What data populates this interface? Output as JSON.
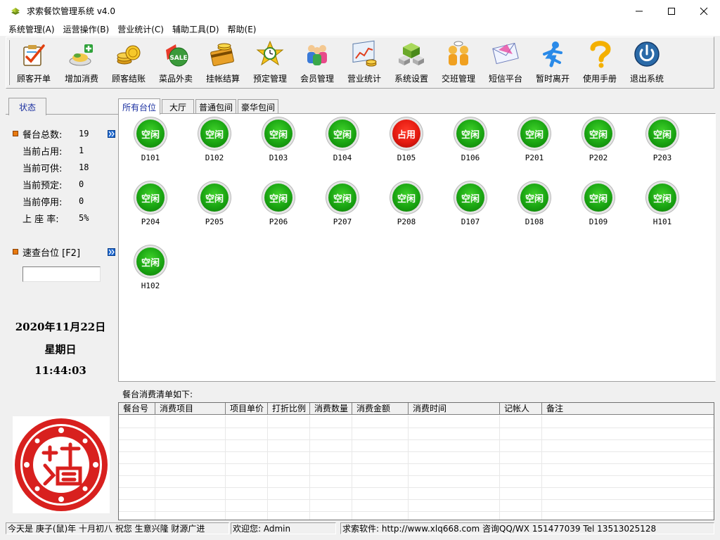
{
  "window": {
    "title": "求索餐饮管理系统 v4.0"
  },
  "menu": [
    {
      "label": "系统管理(A)"
    },
    {
      "label": "运营操作(B)"
    },
    {
      "label": "营业统计(C)"
    },
    {
      "label": "辅助工具(D)"
    },
    {
      "label": "帮助(E)"
    }
  ],
  "toolbar": [
    {
      "label": "顾客开单",
      "icon": "clipboard-check-icon"
    },
    {
      "label": "增加消费",
      "icon": "add-food-icon"
    },
    {
      "label": "顾客结账",
      "icon": "coins-icon"
    },
    {
      "label": "菜品外卖",
      "icon": "sale-bag-icon"
    },
    {
      "label": "挂帐结算",
      "icon": "card-credit-icon"
    },
    {
      "label": "预定管理",
      "icon": "clock-star-icon"
    },
    {
      "label": "会员管理",
      "icon": "members-icon"
    },
    {
      "label": "营业统计",
      "icon": "stats-chart-icon"
    },
    {
      "label": "系统设置",
      "icon": "cubes-icon"
    },
    {
      "label": "交班管理",
      "icon": "handover-people-icon"
    },
    {
      "label": "短信平台",
      "icon": "envelope-icon"
    },
    {
      "label": "暂时离开",
      "icon": "running-man-icon"
    },
    {
      "label": "使用手册",
      "icon": "question-icon"
    },
    {
      "label": "退出系统",
      "icon": "power-icon"
    }
  ],
  "left_panel": {
    "tab": "状态",
    "stats": [
      {
        "label": "餐台总数:",
        "value": "19"
      },
      {
        "label": "当前占用:",
        "value": "1"
      },
      {
        "label": "当前可供:",
        "value": "18"
      },
      {
        "label": "当前预定:",
        "value": "0"
      },
      {
        "label": "当前停用:",
        "value": "0"
      },
      {
        "label": "上 座 率:",
        "value": "5%"
      }
    ],
    "quick_search": "速查台位 [F2]",
    "quick_search_value": "",
    "date": "2020年11月22日",
    "weekday": "星期日",
    "time": "11:44:03",
    "seal_icon": "red-paper-cut-seal-icon"
  },
  "area_tabs": [
    {
      "label": "所有台位"
    },
    {
      "label": "大厅"
    },
    {
      "label": "普通包间"
    },
    {
      "label": "豪华包间"
    }
  ],
  "tables": [
    {
      "code": "D101",
      "status": "空闲",
      "state": "free"
    },
    {
      "code": "D102",
      "status": "空闲",
      "state": "free"
    },
    {
      "code": "D103",
      "status": "空闲",
      "state": "free"
    },
    {
      "code": "D104",
      "status": "空闲",
      "state": "free"
    },
    {
      "code": "D105",
      "status": "占用",
      "state": "busy"
    },
    {
      "code": "D106",
      "status": "空闲",
      "state": "free"
    },
    {
      "code": "P201",
      "status": "空闲",
      "state": "free"
    },
    {
      "code": "P202",
      "status": "空闲",
      "state": "free"
    },
    {
      "code": "P203",
      "status": "空闲",
      "state": "free"
    },
    {
      "code": "P204",
      "status": "空闲",
      "state": "free"
    },
    {
      "code": "P205",
      "status": "空闲",
      "state": "free"
    },
    {
      "code": "P206",
      "status": "空闲",
      "state": "free"
    },
    {
      "code": "P207",
      "status": "空闲",
      "state": "free"
    },
    {
      "code": "P208",
      "status": "空闲",
      "state": "free"
    },
    {
      "code": "D107",
      "status": "空闲",
      "state": "free"
    },
    {
      "code": "D108",
      "status": "空闲",
      "state": "free"
    },
    {
      "code": "D109",
      "status": "空闲",
      "state": "free"
    },
    {
      "code": "H101",
      "status": "空闲",
      "state": "free"
    },
    {
      "code": "H102",
      "status": "空闲",
      "state": "free"
    }
  ],
  "orders": {
    "title": "餐台消费清单如下:",
    "columns": [
      {
        "label": "餐台号"
      },
      {
        "label": "消费项目"
      },
      {
        "label": "项目单价"
      },
      {
        "label": "打折比例"
      },
      {
        "label": "消费数量"
      },
      {
        "label": "消费金额"
      },
      {
        "label": "消费时间"
      },
      {
        "label": "记帐人"
      },
      {
        "label": "备注"
      }
    ],
    "rows": []
  },
  "statusbar": {
    "greeting": "今天是 庚子(鼠)年 十月初八 祝您 生意兴隆 财源广进",
    "welcome": "欢迎您: Admin",
    "company": "求索软件: http://www.xlq668.com  咨询QQ/WX 151477039  Tel 13513025128"
  },
  "colors": {
    "free": "#1aa512",
    "busy": "#e41a10",
    "tab_text": "#1a2fa0",
    "bullet": "#e87a10",
    "seal": "#d8201e"
  }
}
